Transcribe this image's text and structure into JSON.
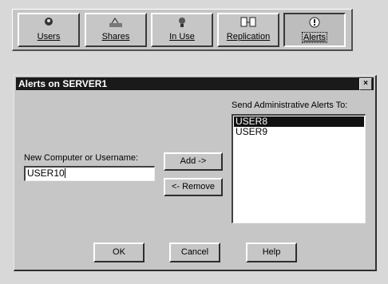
{
  "toolbar": {
    "buttons": [
      {
        "label": "Users",
        "icon": "users-icon"
      },
      {
        "label": "Shares",
        "icon": "shares-icon"
      },
      {
        "label": "In Use",
        "icon": "in-use-icon"
      },
      {
        "label": "Replication",
        "icon": "replication-icon"
      },
      {
        "label": "Alerts",
        "icon": "alerts-icon"
      }
    ]
  },
  "dialog": {
    "title": "Alerts on SERVER1",
    "close": "×",
    "new_label": "New Computer or Username:",
    "new_value": "USER10",
    "send_label": "Send Administrative Alerts To:",
    "alert_list": [
      "USER8",
      "USER9"
    ],
    "add_label": "Add ->",
    "remove_label": "<- Remove",
    "ok_label": "OK",
    "cancel_label": "Cancel",
    "help_label": "Help"
  }
}
